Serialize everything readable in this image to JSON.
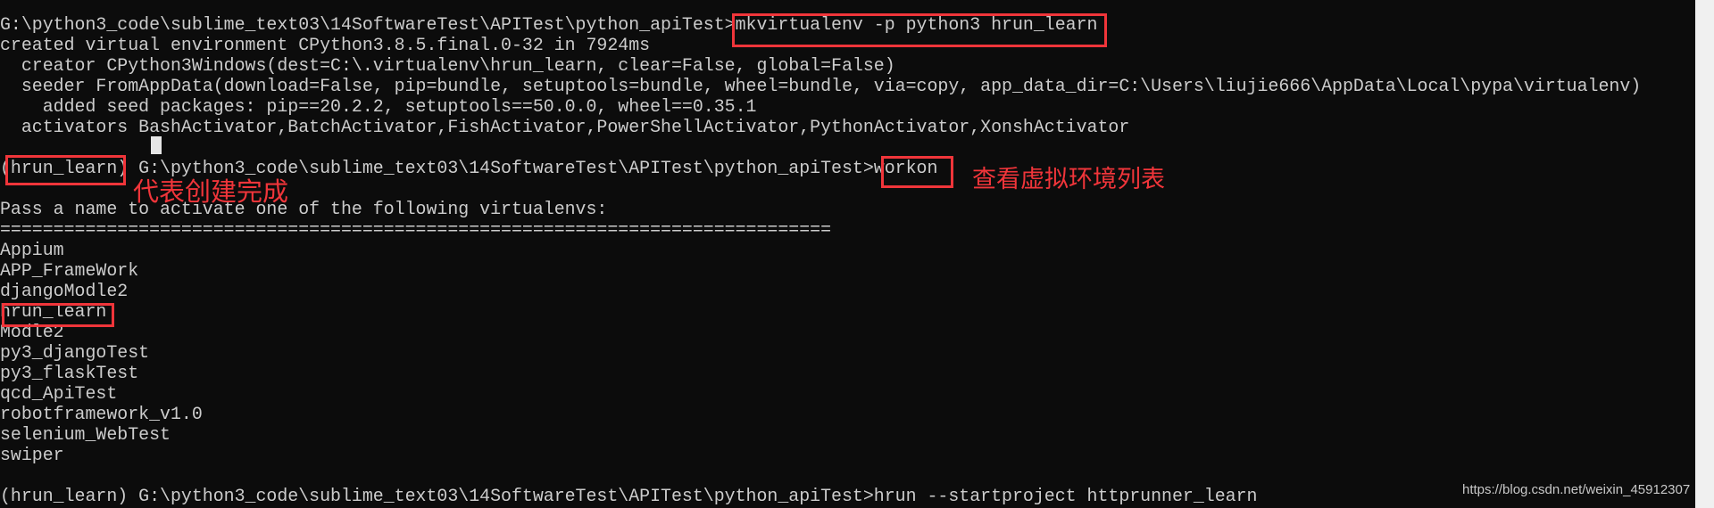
{
  "terminal": {
    "lines": [
      "G:\\python3_code\\sublime_text03\\14SoftwareTest\\APITest\\python_apiTest>mkvirtualenv -p python3 hrun_learn",
      "created virtual environment CPython3.8.5.final.0-32 in 7924ms",
      "  creator CPython3Windows(dest=C:\\.virtualenv\\hrun_learn, clear=False, global=False)",
      "  seeder FromAppData(download=False, pip=bundle, setuptools=bundle, wheel=bundle, via=copy, app_data_dir=C:\\Users\\liujie666\\AppData\\Local\\pypa\\virtualenv)",
      "    added seed packages: pip==20.2.2, setuptools==50.0.0, wheel==0.35.1",
      "  activators BashActivator,BatchActivator,FishActivator,PowerShellActivator,PythonActivator,XonshActivator",
      "",
      "(hrun_learn) G:\\python3_code\\sublime_text03\\14SoftwareTest\\APITest\\python_apiTest>workon",
      "",
      "Pass a name to activate one of the following virtualenvs:",
      "==============================================================================",
      "Appium",
      "APP_FrameWork",
      "djangoModle2",
      "hrun_learn",
      "Modle2",
      "py3_djangoTest",
      "py3_flaskTest",
      "qcd_ApiTest",
      "robotframework_v1.0",
      "selenium_WebTest",
      "swiper",
      "",
      "(hrun_learn) G:\\python3_code\\sublime_text03\\14SoftwareTest\\APITest\\python_apiTest>hrun --startproject httprunner_learn"
    ]
  },
  "annotations": {
    "created_note": "代表创建完成",
    "workon_note": "查看虚拟环境列表",
    "highlight_color": "#f0353a"
  },
  "watermark": "https://blog.csdn.net/weixin_45912307"
}
